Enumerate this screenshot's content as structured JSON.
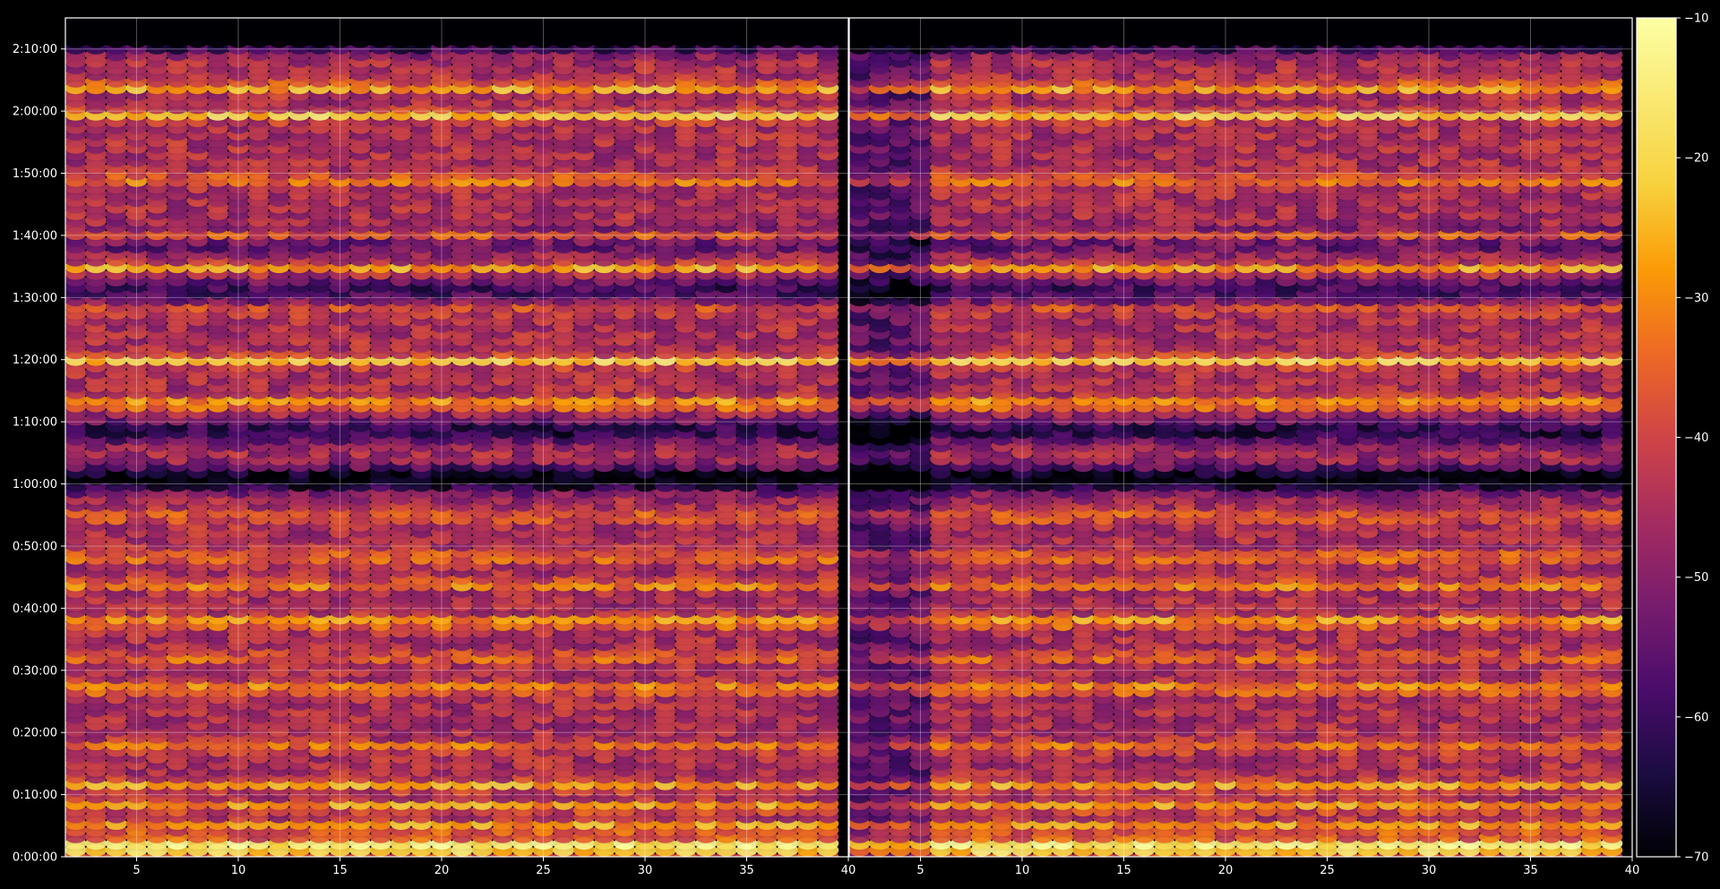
{
  "chart_data": {
    "type": "heatmap",
    "title": "",
    "xlabel": "",
    "ylabel": "",
    "panels": [
      {
        "name": "",
        "xlim": [
          1.5,
          40
        ],
        "ylim": [
          0,
          8100
        ]
      },
      {
        "name": "",
        "xlim": [
          1.5,
          40
        ],
        "ylim": [
          0,
          8100
        ]
      }
    ],
    "x_ticks": [
      5,
      10,
      15,
      20,
      25,
      30,
      35,
      40
    ],
    "x_tick_labels": [
      "5",
      "10",
      "15",
      "20",
      "25",
      "30",
      "35",
      "40"
    ],
    "y_ticks_seconds": [
      0,
      600,
      1200,
      1800,
      2400,
      3000,
      3600,
      4200,
      4800,
      5400,
      6000,
      6600,
      7200,
      7800
    ],
    "y_tick_labels": [
      "0:00:00",
      "0:10:00",
      "0:20:00",
      "0:30:00",
      "0:40:00",
      "0:50:00",
      "1:00:00",
      "1:10:00",
      "1:20:00",
      "1:30:00",
      "1:40:00",
      "1:50:00",
      "2:00:00",
      "2:10:00"
    ],
    "grid": true,
    "colorbar": {
      "colormap": "inferno",
      "range": [
        -70,
        -10
      ],
      "ticks": [
        -70,
        -60,
        -50,
        -40,
        -30,
        -20,
        -10
      ],
      "tick_labels": [
        "−70",
        "−60",
        "−50",
        "−40",
        "−30",
        "−20",
        "−10"
      ]
    },
    "value_description": "dense grid of elliptical markers; bright horizontal bands near 0:00–0:10, 0:27, 0:38, 0:52, 1:12–1:20, 1:40, 2:00 and 2:06; dark bands near 1:00 and 2:10+",
    "marker": "ellipse"
  }
}
